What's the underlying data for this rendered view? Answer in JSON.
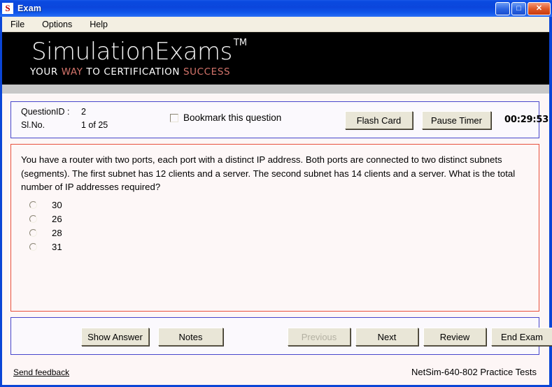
{
  "window": {
    "title": "Exam",
    "icon": "S",
    "minimize_glyph": "_",
    "maximize_glyph": "□",
    "close_glyph": "✕"
  },
  "menu": {
    "items": [
      {
        "label": "File"
      },
      {
        "label": "Options"
      },
      {
        "label": "Help"
      }
    ]
  },
  "banner": {
    "brand": "SimulationExams",
    "trademark": "TM",
    "tagline_parts": [
      {
        "text": "YOUR ",
        "highlight": false
      },
      {
        "text": "WAY",
        "highlight": true
      },
      {
        "text": " TO CERTIFICATION ",
        "highlight": false
      },
      {
        "text": "SUCCESS",
        "highlight": true
      }
    ],
    "tagline_plain": "YOUR WAY TO CERTIFICATION SUCCESS",
    "highlight_color": "#d4746b"
  },
  "info": {
    "question_id_label": "QuestionID :",
    "question_id_value": "2",
    "slno_label": "Sl.No.",
    "slno_value": "1 of 25",
    "bookmark_label": "Bookmark this question",
    "bookmark_checked": false,
    "flash_card_label": "Flash Card",
    "pause_timer_label": "Pause Timer",
    "timer": "00:29:53",
    "border_color": "#4646cc"
  },
  "question": {
    "text": "You have a router with two ports, each port with a distinct IP address. Both ports are connected to two distinct subnets (segments). The first subnet has 12 clients and a server. The second subnet has 14 clients and a server. What is the total number of IP addresses required?",
    "border_color": "#e8503c",
    "options": [
      {
        "label": "30",
        "selected": false
      },
      {
        "label": "26",
        "selected": false
      },
      {
        "label": "28",
        "selected": false
      },
      {
        "label": "31",
        "selected": false
      }
    ]
  },
  "nav": {
    "border_color": "#4646cc",
    "show_answer_label": "Show Answer",
    "notes_label": "Notes",
    "previous_label": "Previous",
    "previous_disabled": true,
    "next_label": "Next",
    "review_label": "Review",
    "end_exam_label": "End Exam"
  },
  "footer": {
    "send_feedback_label": "Send feedback",
    "product_label": "NetSim-640-802 Practice Tests"
  }
}
